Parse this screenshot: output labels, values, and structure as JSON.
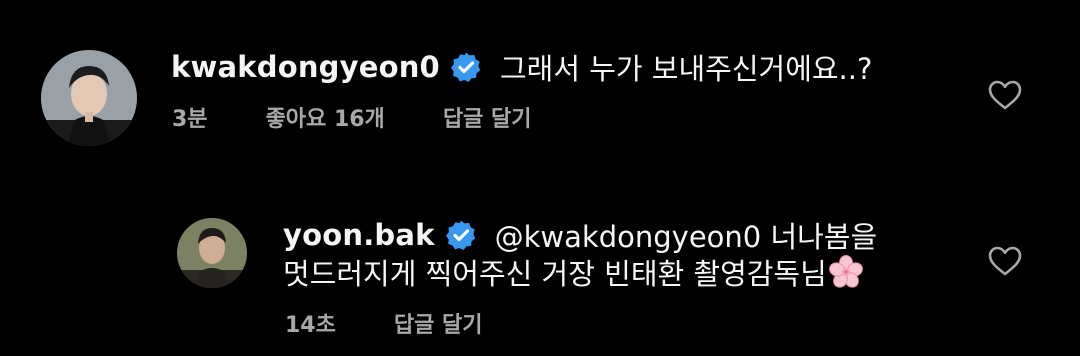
{
  "comments": [
    {
      "username": "kwakdongyeon0",
      "text": "그래서 누가 보내주신거에요..?",
      "time": "3분",
      "likes": "좋아요 16개",
      "reply": "답글 달기",
      "verified_color": "#3897f0"
    },
    {
      "username": "yoon.bak",
      "text_line1": "@kwakdongyeon0 너나봄을",
      "text_line2": "멋드러지게 찍어주신 거장 빈태환 촬영감독님",
      "time": "14초",
      "reply": "답글 달기",
      "verified_color": "#3897f0"
    }
  ],
  "icons": {
    "like": "heart-outline-icon",
    "verified": "verified-badge-icon",
    "emoji": "cherry-blossom-emoji"
  },
  "colors": {
    "background": "#000000",
    "text": "#f5f5f5",
    "secondary_text": "#a8a8a8"
  }
}
